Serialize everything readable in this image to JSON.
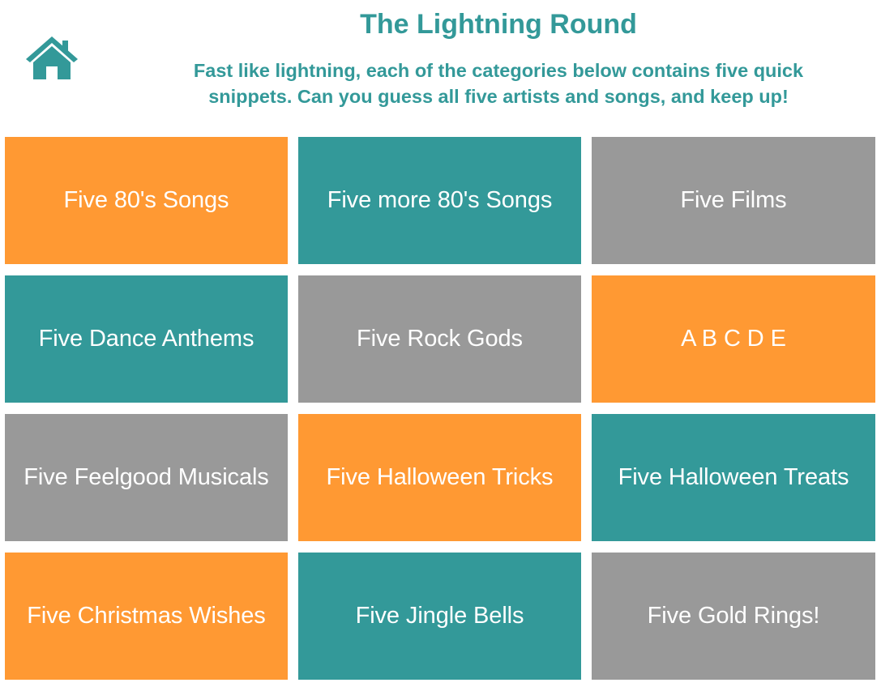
{
  "colors": {
    "teal": "#339999",
    "orange": "#FF9933",
    "gray": "#999999",
    "title": "#339999"
  },
  "header": {
    "home_icon": "home-icon",
    "title": "The Lightning Round",
    "subtitle_line1": "Fast like lightning, each of the categories below contains five quick",
    "subtitle_line2": "snippets. Can you guess all five artists and songs, and keep up!"
  },
  "categories": [
    {
      "label": "Five 80's Songs",
      "color": "#FF9933"
    },
    {
      "label": "Five more 80's Songs",
      "color": "#339999"
    },
    {
      "label": "Five Films",
      "color": "#999999"
    },
    {
      "label": "Five Dance Anthems",
      "color": "#339999"
    },
    {
      "label": "Five Rock Gods",
      "color": "#999999"
    },
    {
      "label": "A B C D E",
      "color": "#FF9933"
    },
    {
      "label": "Five Feelgood Musicals",
      "color": "#999999"
    },
    {
      "label": "Five Halloween Tricks",
      "color": "#FF9933"
    },
    {
      "label": "Five Halloween Treats",
      "color": "#339999"
    },
    {
      "label": "Five Christmas Wishes",
      "color": "#FF9933"
    },
    {
      "label": "Five Jingle Bells",
      "color": "#339999"
    },
    {
      "label": "Five Gold Rings!",
      "color": "#999999"
    }
  ]
}
